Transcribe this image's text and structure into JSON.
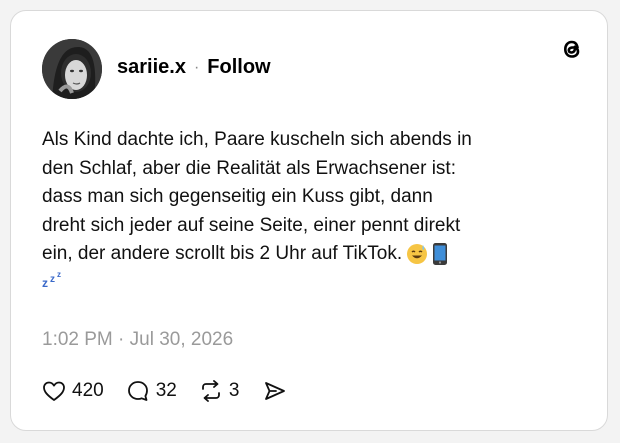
{
  "post": {
    "username": "sariie.x",
    "separator": "·",
    "follow_label": "Follow",
    "text_lines": [
      "Als Kind dachte ich, Paare kuscheln sich abends in",
      "den Schlaf, aber die Realität als Erwachsener ist:",
      "dass man sich gegenseitig ein Kuss gibt, dann",
      "dreht sich jeder auf seine Seite, einer pennt direkt",
      "ein, der andere scrollt bis 2 Uhr auf TikTok."
    ],
    "emojis": [
      "sweat-smile-emoji",
      "mobile-phone-emoji",
      "zzz-emoji"
    ],
    "timestamp": "1:02 PM · Jul 30, 2026",
    "likes": "420",
    "comments": "32",
    "reposts": "3"
  },
  "icons": {
    "brand": "threads-logo-icon",
    "like": "heart-icon",
    "comment": "comment-icon",
    "repost": "repost-icon",
    "share": "send-icon"
  },
  "colors": {
    "text": "#111111",
    "muted": "#9a9a9a",
    "border": "#d9d9d9",
    "card": "#ffffff"
  }
}
